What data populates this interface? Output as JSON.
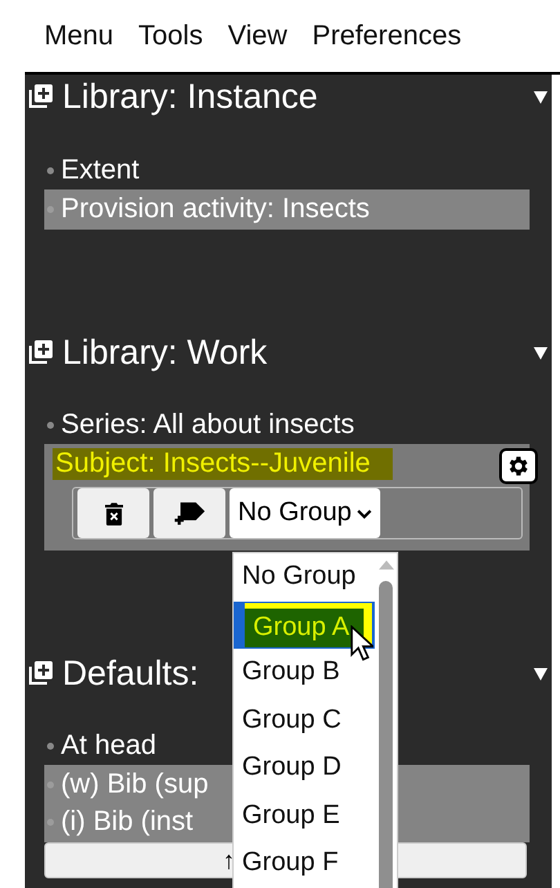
{
  "menu": [
    {
      "label": "Menu"
    },
    {
      "label": "Tools"
    },
    {
      "label": "View"
    },
    {
      "label": "Preferences"
    }
  ],
  "sections": [
    {
      "title": "Library: Instance",
      "items": [
        {
          "text": "Extent",
          "selected": false,
          "highlighted": false
        },
        {
          "text": "Provision activity: Insects",
          "selected": true,
          "highlighted": false
        }
      ]
    },
    {
      "title": "Library: Work",
      "items": [
        {
          "text": "Series: All about insects",
          "selected": false,
          "highlighted": false
        },
        {
          "text": "Subject: Insects--Juvenile",
          "selected": true,
          "highlighted": true,
          "group_select": "No Group"
        }
      ]
    },
    {
      "title": "Defaults:",
      "items": [
        {
          "text": "At head",
          "selected": false,
          "highlighted": false
        },
        {
          "text": "(w) Bib (sup",
          "selected": true,
          "highlighted": false
        },
        {
          "text": "(i) Bib (inst",
          "selected": true,
          "highlighted": false
        }
      ],
      "footer_button": "↑"
    }
  ],
  "dropdown": [
    {
      "label": "No Group",
      "selected": false
    },
    {
      "label": "Group A",
      "selected": true
    },
    {
      "label": "Group B",
      "selected": false
    },
    {
      "label": "Group C",
      "selected": false
    },
    {
      "label": "Group D",
      "selected": false
    },
    {
      "label": "Group E",
      "selected": false
    },
    {
      "label": "Group F",
      "selected": false
    }
  ]
}
